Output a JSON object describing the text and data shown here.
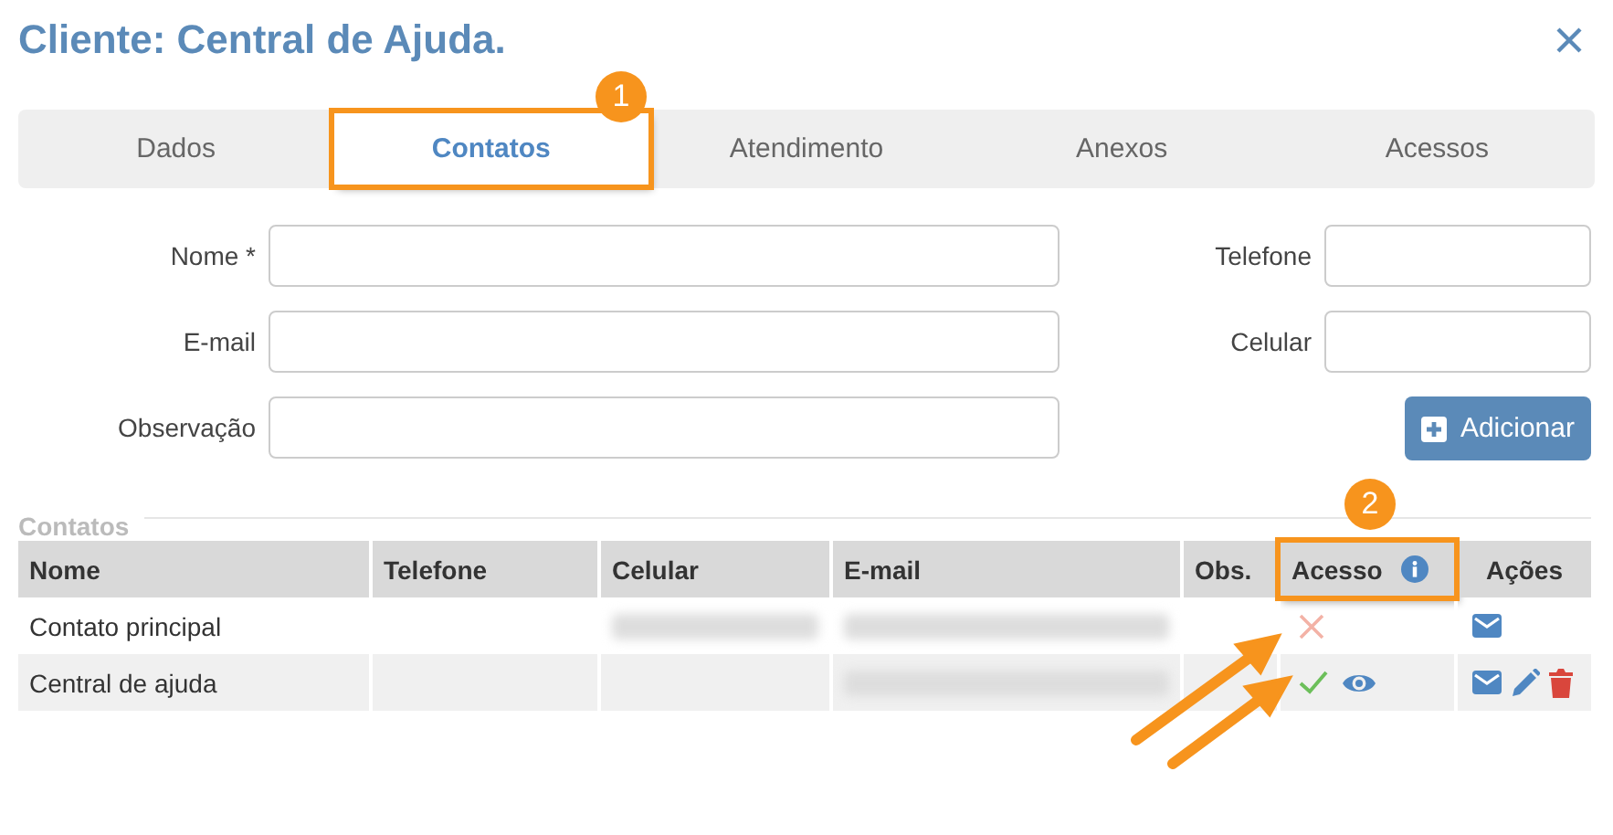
{
  "window": {
    "title": "Cliente: Central de Ajuda."
  },
  "tabs": [
    {
      "label": "Dados",
      "selected": false,
      "highlighted": false
    },
    {
      "label": "Contatos",
      "selected": true,
      "highlighted": true
    },
    {
      "label": "Atendimento",
      "selected": false,
      "highlighted": false
    },
    {
      "label": "Anexos",
      "selected": false,
      "highlighted": false
    },
    {
      "label": "Acessos",
      "selected": false,
      "highlighted": false
    }
  ],
  "form": {
    "left": [
      {
        "label": "Nome *"
      },
      {
        "label": "E-mail"
      },
      {
        "label": "Observação"
      }
    ],
    "right": [
      {
        "label": "Telefone"
      },
      {
        "label": "Celular"
      }
    ],
    "add_button": "Adicionar"
  },
  "contacts": {
    "title": "Contatos",
    "columns": [
      {
        "label": "Nome",
        "highlighted": false
      },
      {
        "label": "Telefone",
        "highlighted": false
      },
      {
        "label": "Celular",
        "highlighted": false
      },
      {
        "label": "E-mail",
        "highlighted": false
      },
      {
        "label": "Obs.",
        "highlighted": false
      },
      {
        "label": "Acesso",
        "highlighted": true,
        "info": true
      },
      {
        "label": "Ações",
        "highlighted": false
      }
    ],
    "rows": [
      {
        "name": "Contato principal",
        "phone_blurred": false,
        "mobile_blurred": true,
        "email_blurred": true,
        "access": false,
        "actions": [
          {
            "kind": "email"
          }
        ]
      },
      {
        "name": "Central de ajuda",
        "phone_blurred": false,
        "mobile_blurred": false,
        "email_blurred": true,
        "access": true,
        "actions": [
          {
            "kind": "email"
          },
          {
            "kind": "edit"
          },
          {
            "kind": "delete"
          }
        ]
      }
    ]
  },
  "callouts": [
    {
      "number": "1",
      "kind": "tab"
    },
    {
      "number": "2",
      "kind": "column"
    }
  ]
}
